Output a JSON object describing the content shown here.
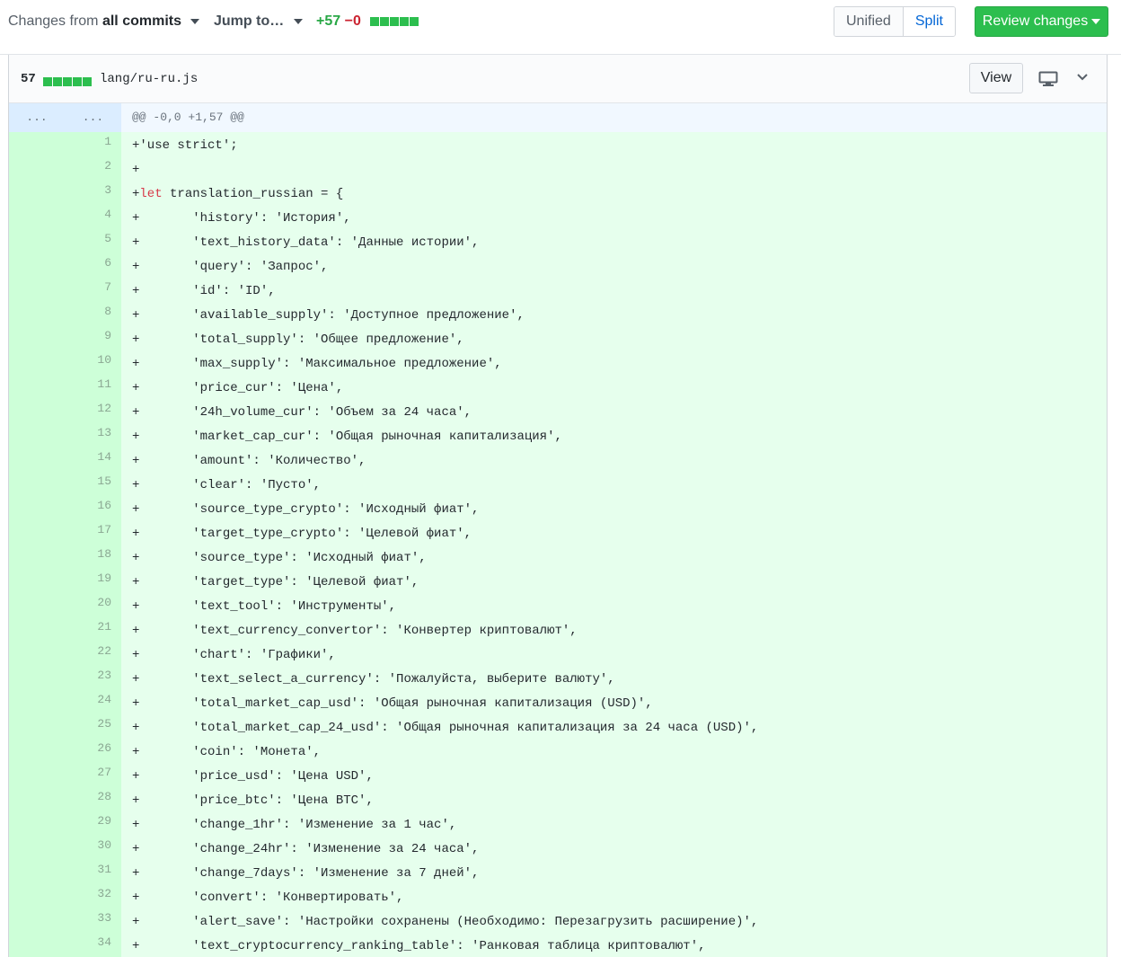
{
  "toolbar": {
    "changes_prefix": "Changes from",
    "changes_scope": "all commits",
    "jump_label": "Jump to…",
    "additions": "+57",
    "deletions": "−0",
    "unified_label": "Unified",
    "split_label": "Split",
    "review_label": "Review changes"
  },
  "file": {
    "change_count": "57",
    "path": "lang/ru-ru.js",
    "view_label": "View",
    "hunk_old_marker": "...",
    "hunk_new_marker": "...",
    "hunk_header": "@@ -0,0 +1,57 @@"
  },
  "lines": [
    {
      "n": "1",
      "code": "+'use strict';"
    },
    {
      "n": "2",
      "code": "+"
    },
    {
      "n": "3",
      "code": "+let translation_russian = {"
    },
    {
      "n": "4",
      "code": "+       'history': 'История',"
    },
    {
      "n": "5",
      "code": "+       'text_history_data': 'Данные истории',"
    },
    {
      "n": "6",
      "code": "+       'query': 'Запрос',"
    },
    {
      "n": "7",
      "code": "+       'id': 'ID',"
    },
    {
      "n": "8",
      "code": "+       'available_supply': 'Доступное предложение',"
    },
    {
      "n": "9",
      "code": "+       'total_supply': 'Общее предложение',"
    },
    {
      "n": "10",
      "code": "+       'max_supply': 'Максимальное предложение',"
    },
    {
      "n": "11",
      "code": "+       'price_cur': 'Цена',"
    },
    {
      "n": "12",
      "code": "+       '24h_volume_cur': 'Объем за 24 часа',"
    },
    {
      "n": "13",
      "code": "+       'market_cap_cur': 'Общая рыночная капитализация',"
    },
    {
      "n": "14",
      "code": "+       'amount': 'Количество',"
    },
    {
      "n": "15",
      "code": "+       'clear': 'Пусто',"
    },
    {
      "n": "16",
      "code": "+       'source_type_crypto': 'Исходный фиат',"
    },
    {
      "n": "17",
      "code": "+       'target_type_crypto': 'Целевой фиат',"
    },
    {
      "n": "18",
      "code": "+       'source_type': 'Исходный фиат',"
    },
    {
      "n": "19",
      "code": "+       'target_type': 'Целевой фиат',"
    },
    {
      "n": "20",
      "code": "+       'text_tool': 'Инструменты',"
    },
    {
      "n": "21",
      "code": "+       'text_currency_convertor': 'Конвертер криптовалют',"
    },
    {
      "n": "22",
      "code": "+       'chart': 'Графики',"
    },
    {
      "n": "23",
      "code": "+       'text_select_a_currency': 'Пожалуйста, выберите валюту',"
    },
    {
      "n": "24",
      "code": "+       'total_market_cap_usd': 'Общая рыночная капитализация (USD)',"
    },
    {
      "n": "25",
      "code": "+       'total_market_cap_24_usd': 'Общая рыночная капитализация за 24 часа (USD)',"
    },
    {
      "n": "26",
      "code": "+       'coin': 'Монета',"
    },
    {
      "n": "27",
      "code": "+       'price_usd': 'Цена USD',"
    },
    {
      "n": "28",
      "code": "+       'price_btc': 'Цена BTC',"
    },
    {
      "n": "29",
      "code": "+       'change_1hr': 'Изменение за 1 час',"
    },
    {
      "n": "30",
      "code": "+       'change_24hr': 'Изменение за 24 часа',"
    },
    {
      "n": "31",
      "code": "+       'change_7days': 'Изменение за 7 дней',"
    },
    {
      "n": "32",
      "code": "+       'convert': 'Конвертировать',"
    },
    {
      "n": "33",
      "code": "+       'alert_save': 'Настройки сохранены (Необходимо: Перезагрузить расширение)',"
    },
    {
      "n": "34",
      "code": "+       'text_cryptocurrency_ranking_table': 'Ранковая таблица криптовалют',"
    }
  ]
}
